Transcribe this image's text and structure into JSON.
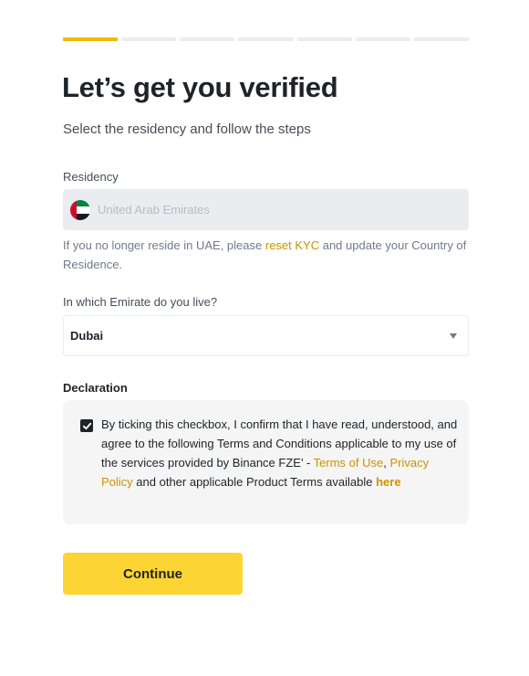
{
  "progress": {
    "total_steps": 7,
    "current_step": 1,
    "active_color": "#f0b90b",
    "inactive_color": "#eaecef"
  },
  "page": {
    "title": "Let’s get you verified",
    "subtitle": "Select the residency and follow the steps"
  },
  "residency": {
    "label": "Residency",
    "value": "United Arab Emirates",
    "flag_icon": "uae-flag-icon",
    "help_prefix": "If you no longer reside in UAE, please ",
    "help_link": "reset KYC",
    "help_suffix": " and update your Country of Residence."
  },
  "emirate": {
    "label": "In which Emirate do you live?",
    "value": "Dubai",
    "dropdown_icon": "caret-down-icon"
  },
  "declaration": {
    "label": "Declaration",
    "checked": true,
    "text_main": "By ticking this checkbox, I confirm that I have read, understood, and agree to the following Terms and Conditions applicable to my use of the services provided by Binance FZE’ - ",
    "terms_link": "Terms of Use",
    "comma": ",",
    "privacy_link": "Privacy Policy",
    "text_mid": " and other applicable Product Terms available ",
    "here_link": "here"
  },
  "actions": {
    "continue_label": "Continue",
    "continue_color": "#fcd535"
  },
  "colors": {
    "accent_link": "#c99400"
  }
}
